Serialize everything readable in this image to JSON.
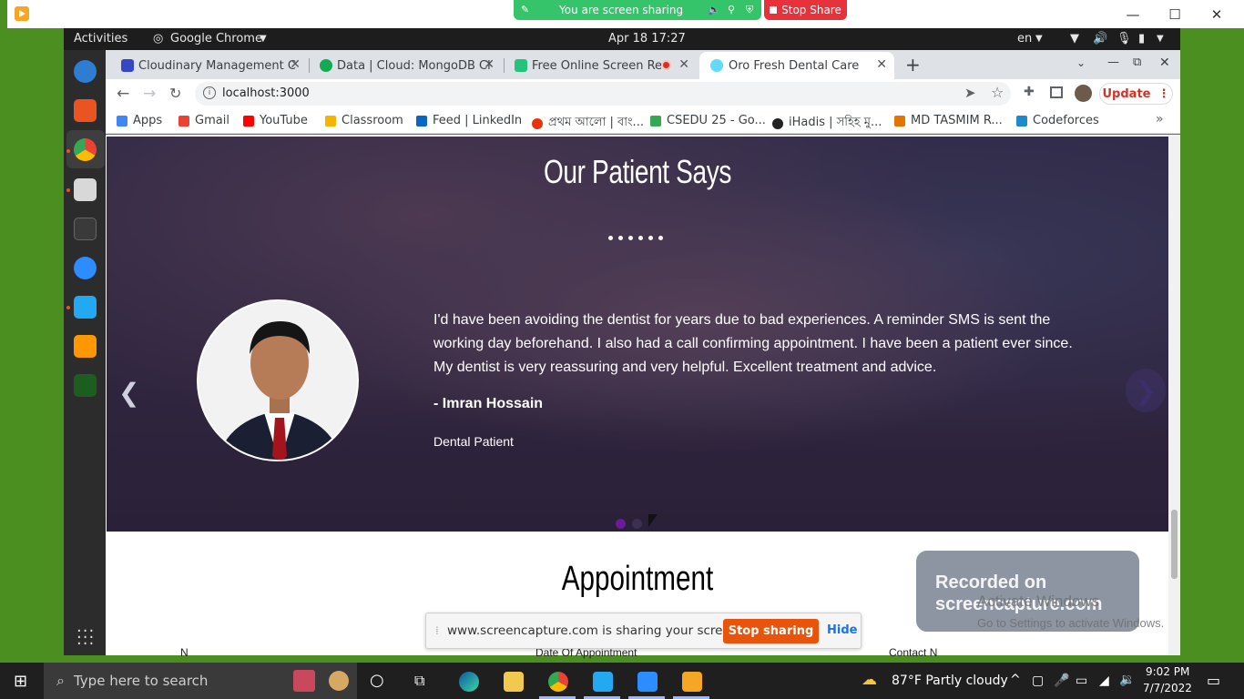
{
  "recorder": {
    "sharing_text": "You are screen sharing",
    "stop_share_label": "Stop Share"
  },
  "gnome": {
    "activities": "Activities",
    "app_name": "Google Chrome",
    "datetime": "Apr 18  17:27",
    "language": "en"
  },
  "chrome": {
    "tabs": [
      {
        "label": "Cloudinary Management C",
        "favicon_color": "#3448c5"
      },
      {
        "label": "Data | Cloud: MongoDB Cl",
        "favicon_color": "#13aa52"
      },
      {
        "label": "Free Online Screen Rec",
        "favicon_color": "#24c27a"
      },
      {
        "label": "Oro Fresh Dental Care",
        "favicon_color": "#61dafb"
      }
    ],
    "url": "localhost:3000",
    "update_label": "Update",
    "bookmarks": [
      {
        "label": "Apps",
        "color": "#4285f4"
      },
      {
        "label": "Gmail",
        "color": "#ea4335"
      },
      {
        "label": "YouTube",
        "color": "#ff0000"
      },
      {
        "label": "Classroom",
        "color": "#f4b400"
      },
      {
        "label": "Feed | LinkedIn",
        "color": "#0a66c2"
      },
      {
        "label": "প্রথম আলো | বাং...",
        "color": "#e8340c"
      },
      {
        "label": "CSEDU 25 - Go...",
        "color": "#34a853"
      },
      {
        "label": "iHadis | সহিহ মু...",
        "color": "#222222"
      },
      {
        "label": "MD TASMIM R...",
        "color": "#e37400"
      },
      {
        "label": "Codeforces",
        "color": "#1f8acb"
      }
    ]
  },
  "page": {
    "testimonials_title": "Our Patient Says",
    "testimonial_text": "I'd have been avoiding the dentist for years due to bad experiences. A reminder SMS is sent the working day beforehand. I also had a call confirming appointment. I have been a patient ever since. My dentist is very reassuring and very helpful. Excellent treatment and advice.",
    "author": "- Imran Hossain",
    "author_role": "Dental Patient",
    "prev_arrow": "❮",
    "next_arrow": "❯",
    "active_slide": 1,
    "slide_count": 2,
    "appointment_title": "Appointment",
    "form_labels": [
      "N",
      "Date Of Appointment",
      "Contact N"
    ]
  },
  "screencapture": {
    "share_text": "www.screencapture.com is sharing your screen.",
    "stop_label": "Stop sharing",
    "hide_label": "Hide",
    "badge_line1": "Recorded on",
    "badge_line2": "screencapture.com",
    "activate_line1": "Activate Windows",
    "activate_line2": "Go to Settings to activate Windows."
  },
  "taskbar": {
    "search_placeholder": "Type here to search",
    "weather": "87°F  Partly cloudy",
    "time": "9:02 PM",
    "date": "7/7/2022"
  },
  "colors": {
    "accent_purple": "#6a1b9a",
    "stop_orange": "#e8540c",
    "update_red": "#d93025"
  }
}
